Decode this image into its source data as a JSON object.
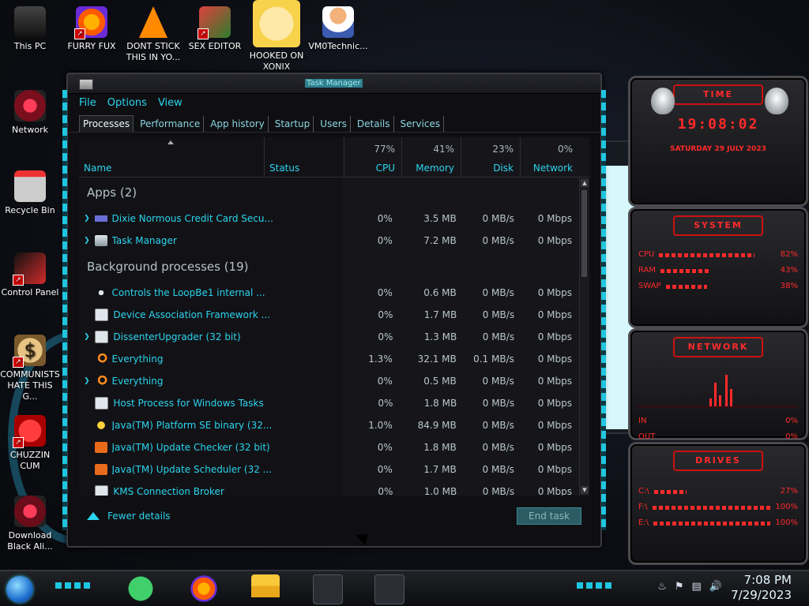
{
  "desktop": {
    "icons": [
      {
        "label": "This PC"
      },
      {
        "label": "FURRY FUX"
      },
      {
        "label": "DONT STICK THIS IN YO..."
      },
      {
        "label": "SEX EDITOR"
      },
      {
        "label": "HOOKED ON XONIX"
      },
      {
        "label": "VM0Technic..."
      },
      {
        "label": "Network"
      },
      {
        "label": "Recycle Bin"
      },
      {
        "label": "Control Panel"
      },
      {
        "label": "COMMUNISTS HATE THIS G..."
      },
      {
        "label": "CHUZZIN CUM"
      },
      {
        "label": "Download Black Ali..."
      }
    ]
  },
  "gadgets": {
    "clock": {
      "title": "TIME",
      "time": "19:08:02",
      "date": "SATURDAY 29 JULY 2023"
    },
    "system": {
      "title": "SYSTEM",
      "rows": [
        {
          "label": "CPU",
          "value": "82%",
          "level": 0.82
        },
        {
          "label": "RAM",
          "value": "43%",
          "level": 0.43
        },
        {
          "label": "SWAP",
          "value": "38%",
          "level": 0.38
        }
      ]
    },
    "network": {
      "title": "NETWORK",
      "rows": [
        {
          "label": "IN",
          "value": "0%"
        },
        {
          "label": "OUT",
          "value": "0%"
        }
      ]
    },
    "drives": {
      "title": "DRIVES",
      "rows": [
        {
          "label": "C:\\",
          "value": "27%",
          "level": 0.27
        },
        {
          "label": "F:\\",
          "value": "100%",
          "level": 1.0
        },
        {
          "label": "E:\\",
          "value": "100%",
          "level": 1.0
        }
      ]
    }
  },
  "taskmgr": {
    "title": "Task Manager",
    "menu": [
      "File",
      "Options",
      "View"
    ],
    "tabs": [
      "Processes",
      "Performance",
      "App history",
      "Startup",
      "Users",
      "Details",
      "Services"
    ],
    "columns": {
      "name": "Name",
      "status": "Status",
      "cpu": {
        "label": "CPU",
        "pct": "77%"
      },
      "memory": {
        "label": "Memory",
        "pct": "41%"
      },
      "disk": {
        "label": "Disk",
        "pct": "23%"
      },
      "network": {
        "label": "Network",
        "pct": "0%"
      }
    },
    "apps_group": "Apps (2)",
    "apps": [
      {
        "name": "Dixie Normous Credit Card Secu...",
        "cpu": "0%",
        "mem": "3.5 MB",
        "disk": "0 MB/s",
        "net": "0 Mbps",
        "expand": true,
        "icon": "card-icon"
      },
      {
        "name": "Task Manager",
        "cpu": "0%",
        "mem": "7.2 MB",
        "disk": "0 MB/s",
        "net": "0 Mbps",
        "expand": true,
        "icon": "taskmgr-icon"
      }
    ],
    "bg_group": "Background processes (19)",
    "background": [
      {
        "name": "Controls the LoopBe1 internal ...",
        "cpu": "0%",
        "mem": "0.6 MB",
        "disk": "0 MB/s",
        "net": "0 Mbps",
        "expand": false,
        "icon": "loop-icon"
      },
      {
        "name": "Device Association Framework ...",
        "cpu": "0%",
        "mem": "1.7 MB",
        "disk": "0 MB/s",
        "net": "0 Mbps",
        "expand": false,
        "icon": "window-icon"
      },
      {
        "name": "DissenterUpgrader (32 bit)",
        "cpu": "0%",
        "mem": "1.3 MB",
        "disk": "0 MB/s",
        "net": "0 Mbps",
        "expand": true,
        "icon": "window-icon"
      },
      {
        "name": "Everything",
        "cpu": "1.3%",
        "mem": "32.1 MB",
        "disk": "0.1 MB/s",
        "net": "0 Mbps",
        "expand": false,
        "icon": "magnifier-icon"
      },
      {
        "name": "Everything",
        "cpu": "0%",
        "mem": "0.5 MB",
        "disk": "0 MB/s",
        "net": "0 Mbps",
        "expand": true,
        "icon": "magnifier-icon"
      },
      {
        "name": "Host Process for Windows Tasks",
        "cpu": "0%",
        "mem": "1.8 MB",
        "disk": "0 MB/s",
        "net": "0 Mbps",
        "expand": false,
        "icon": "window-icon"
      },
      {
        "name": "Java(TM) Platform SE binary (32...",
        "cpu": "1.0%",
        "mem": "84.9 MB",
        "disk": "0 MB/s",
        "net": "0 Mbps",
        "expand": false,
        "icon": "star-icon"
      },
      {
        "name": "Java(TM) Update Checker (32 bit)",
        "cpu": "0%",
        "mem": "1.8 MB",
        "disk": "0 MB/s",
        "net": "0 Mbps",
        "expand": false,
        "icon": "java-icon"
      },
      {
        "name": "Java(TM) Update Scheduler (32 ...",
        "cpu": "0%",
        "mem": "1.7 MB",
        "disk": "0 MB/s",
        "net": "0 Mbps",
        "expand": false,
        "icon": "java-icon"
      },
      {
        "name": "KMS Connection Broker",
        "cpu": "0%",
        "mem": "1.0 MB",
        "disk": "0 MB/s",
        "net": "0 Mbps",
        "expand": false,
        "icon": "window-icon"
      }
    ],
    "fewer_details": "Fewer details",
    "end_task": "End task"
  },
  "taskbar": {
    "clock_time": "7:08 PM",
    "clock_date": "7/29/2023",
    "items": [
      "notes-icon",
      "firefox-icon",
      "file-explorer-icon",
      "credit-card-app-icon",
      "task-manager-icon"
    ]
  },
  "colors": {
    "accent": "#2bd4ee",
    "gadget_red": "#ff2a2a"
  }
}
